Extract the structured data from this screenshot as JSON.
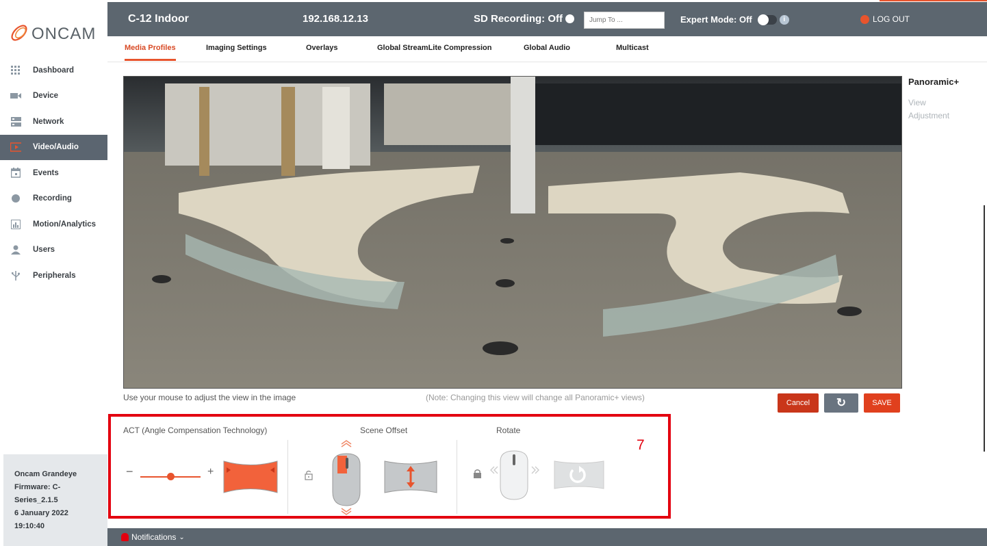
{
  "brand": {
    "logo_text": "ONCAM",
    "accent_color": "#e8542d",
    "header_color": "#5c666f"
  },
  "header": {
    "device_name": "C-12 Indoor",
    "ip": "192.168.12.13",
    "sd_recording": "SD Recording: Off",
    "jump_placeholder": "Jump To ...",
    "expert_mode": "Expert Mode: Off",
    "logout": "LOG OUT"
  },
  "tabs": [
    {
      "label": "Media Profiles",
      "active": true
    },
    {
      "label": "Imaging Settings"
    },
    {
      "label": "Overlays"
    },
    {
      "label": "Global StreamLite Compression"
    },
    {
      "label": "Global Audio"
    },
    {
      "label": "Multicast"
    }
  ],
  "sidebar": {
    "items": [
      {
        "label": "Dashboard",
        "icon": "grid-icon"
      },
      {
        "label": "Device",
        "icon": "camera-icon"
      },
      {
        "label": "Network",
        "icon": "network-icon"
      },
      {
        "label": "Video/Audio",
        "icon": "video-icon",
        "active": true
      },
      {
        "label": "Events",
        "icon": "calendar-icon"
      },
      {
        "label": "Recording",
        "icon": "record-icon"
      },
      {
        "label": "Motion/Analytics",
        "icon": "chart-icon"
      },
      {
        "label": "Users",
        "icon": "user-icon"
      },
      {
        "label": "Peripherals",
        "icon": "usb-icon"
      }
    ],
    "device_info": {
      "model": "Oncam Grandeye",
      "firmware_line1": "Firmware: C-",
      "firmware_line2": "Series_2.1.5",
      "date": "6 January 2022",
      "time": "19:10:40"
    }
  },
  "view": {
    "panel_title": "Panoramic+",
    "panel_sub_1": "View",
    "panel_sub_2": "Adjustment",
    "hint": "Use your mouse to adjust the view in the image",
    "note": "(Note: Changing this view will change all Panoramic+ views)",
    "cancel": "Cancel",
    "refresh": "↻",
    "save": "SAVE"
  },
  "controls": {
    "act_label": "ACT (Angle Compensation Technology)",
    "minus": "−",
    "plus": "+",
    "slider_level": 0.5,
    "scene_offset_label": "Scene Offset",
    "rotate_label": "Rotate",
    "annotation": "7"
  },
  "footer": {
    "notifications": "Notifications"
  }
}
